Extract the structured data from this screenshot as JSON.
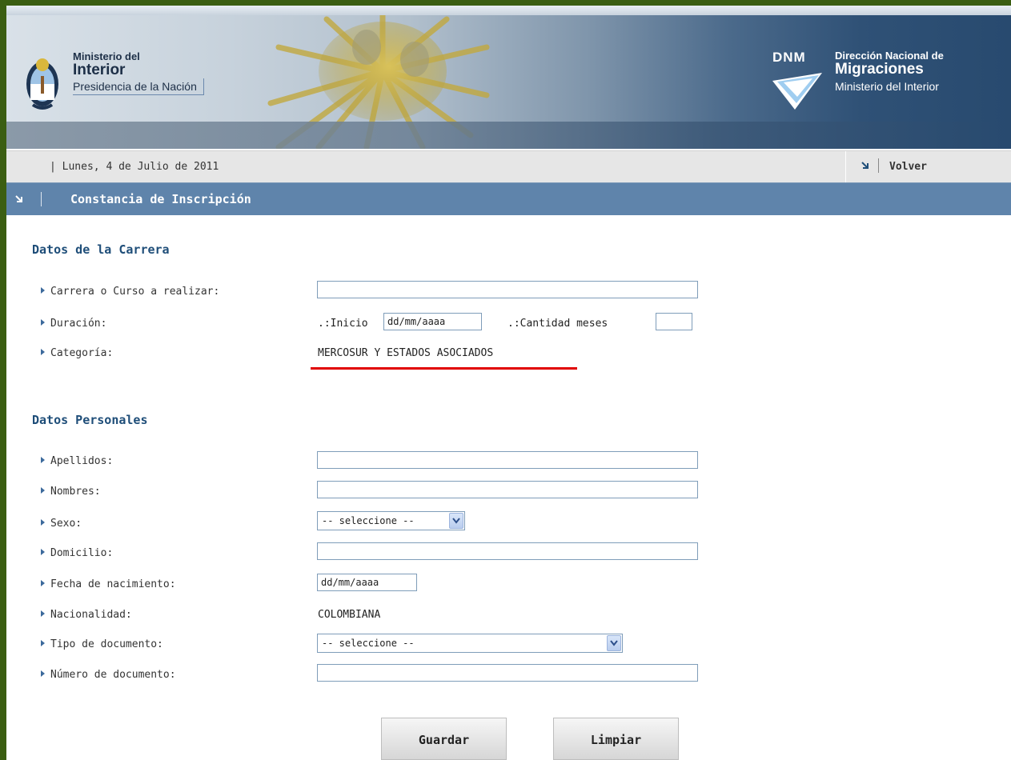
{
  "header": {
    "ministry_line1": "Ministerio del",
    "ministry_line2": "Interior",
    "ministry_line3": "Presidencia de la Nación",
    "dnm_abbr": "DNM",
    "dnm_line1": "Dirección Nacional de",
    "dnm_line2": "Migraciones",
    "dnm_line3": "Ministerio del Interior"
  },
  "datebar": {
    "date": "| Lunes, 4 de Julio de 2011",
    "back_label": "Volver"
  },
  "section": {
    "title": "Constancia de Inscripción"
  },
  "carrera": {
    "heading": "Datos de la Carrera",
    "course_label": "Carrera o Curso a realizar:",
    "course_value": "",
    "duration_label": "Duración:",
    "start_label": ".:Inicio",
    "start_value": "dd/mm/aaaa",
    "months_label": ".:Cantidad meses",
    "months_value": "",
    "category_label": "Categoría:",
    "category_value": "MERCOSUR Y ESTADOS ASOCIADOS"
  },
  "personal": {
    "heading": "Datos Personales",
    "surname_label": "Apellidos:",
    "surname_value": "",
    "names_label": "Nombres:",
    "names_value": "",
    "sex_label": "Sexo:",
    "sex_selected": "-- seleccione --",
    "address_label": "Domicilio:",
    "address_value": "",
    "birth_label": "Fecha de nacimiento:",
    "birth_value": "dd/mm/aaaa",
    "nationality_label": "Nacionalidad:",
    "nationality_value": "COLOMBIANA",
    "doctype_label": "Tipo de documento:",
    "doctype_selected": "-- seleccione --",
    "docnum_label": "Número de documento:",
    "docnum_value": ""
  },
  "actions": {
    "save_label": "Guardar",
    "clear_label": "Limpiar"
  },
  "colors": {
    "frame": "#3b5e12",
    "section_bar": "#5f84ab",
    "heading": "#1f4e79",
    "highlight_underline": "#e00000"
  }
}
